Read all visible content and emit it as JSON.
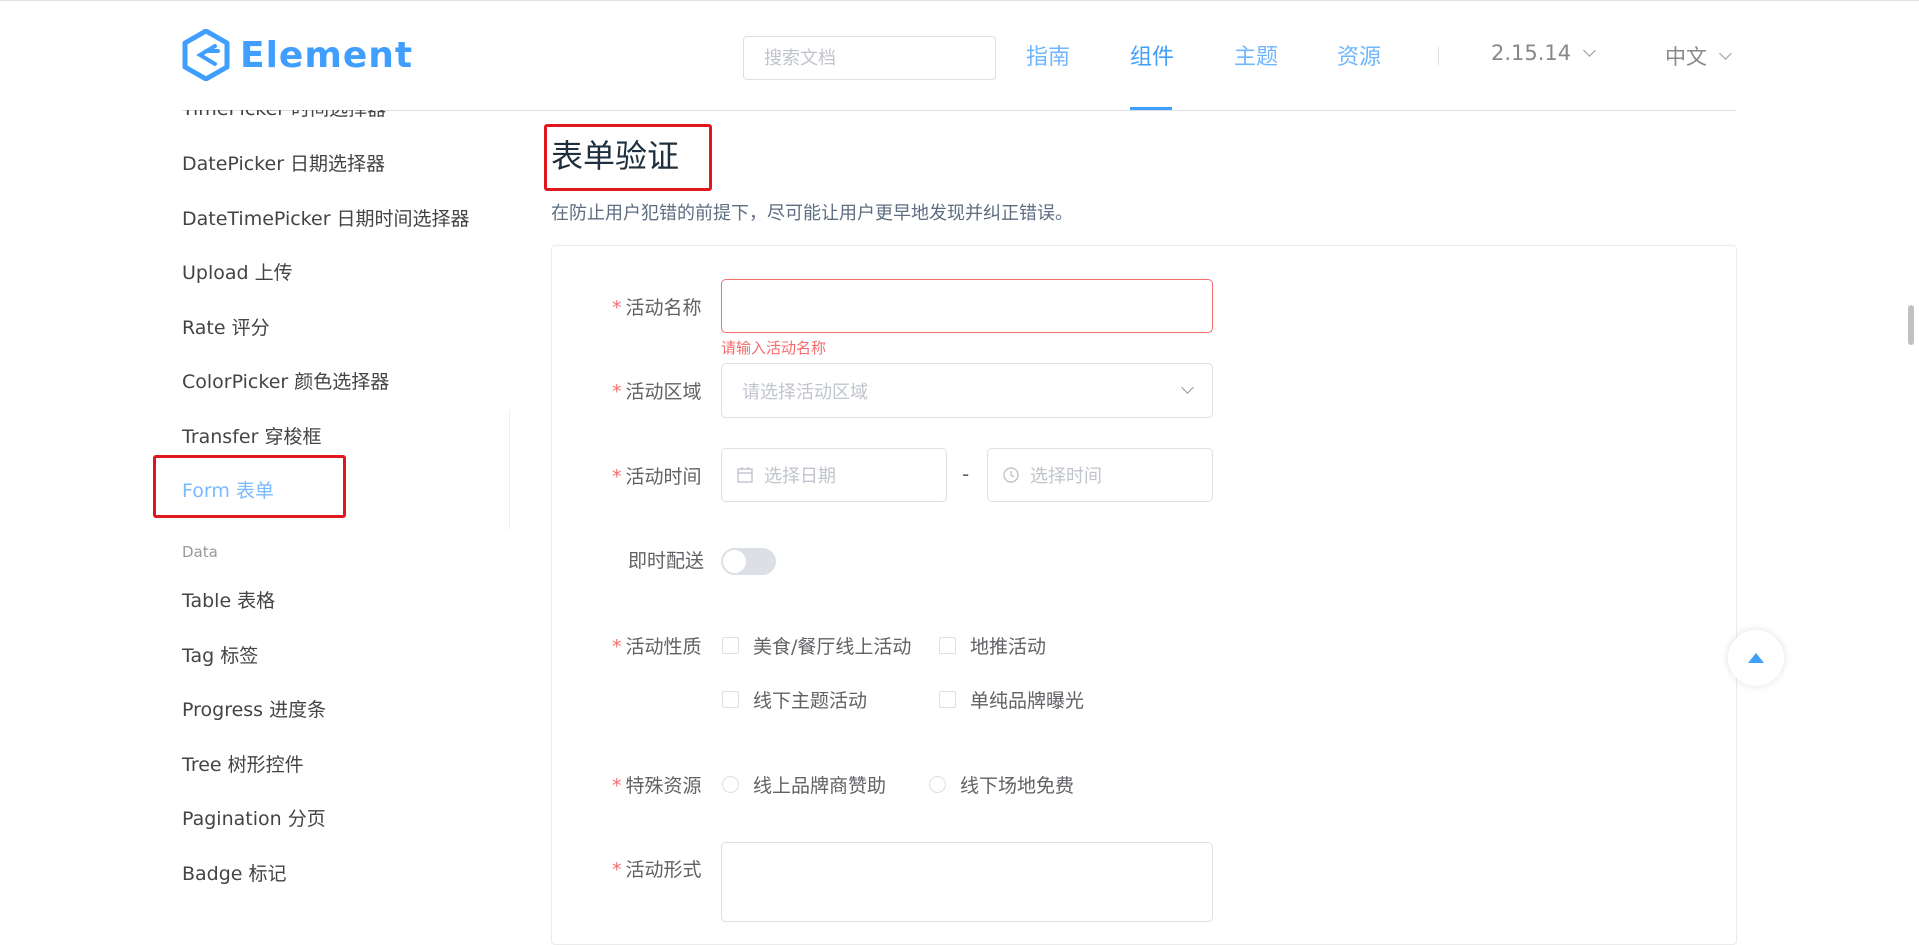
{
  "header": {
    "logo_text": "Element",
    "search_placeholder": "搜索文档",
    "nav": [
      "指南",
      "组件",
      "主题",
      "资源"
    ],
    "version": "2.15.14",
    "language": "中文"
  },
  "sidebar": {
    "items": [
      "TimePicker 时间选择器",
      "DatePicker 日期选择器",
      "DateTimePicker 日期时间选择器",
      "Upload 上传",
      "Rate 评分",
      "ColorPicker 颜色选择器",
      "Transfer 穿梭框",
      "Form 表单"
    ],
    "group_title": "Data",
    "data_items": [
      "Table 表格",
      "Tag 标签",
      "Progress 进度条",
      "Tree 树形控件",
      "Pagination 分页",
      "Badge 标记"
    ]
  },
  "main": {
    "title": "表单验证",
    "description": "在防止用户犯错的前提下，尽可能让用户更早地发现并纠正错误。",
    "form": {
      "required_mark": "*",
      "name_label": "活动名称",
      "name_error": "请输入活动名称",
      "region_label": "活动区域",
      "region_placeholder": "请选择活动区域",
      "time_label": "活动时间",
      "date_placeholder": "选择日期",
      "time_separator": "-",
      "time_placeholder": "选择时间",
      "delivery_label": "即时配送",
      "delivery_on": false,
      "type_label": "活动性质",
      "type_options": [
        "美食/餐厅线上活动",
        "地推活动",
        "线下主题活动",
        "单纯品牌曝光"
      ],
      "resource_label": "特殊资源",
      "resource_options": [
        "线上品牌商赞助",
        "线下场地免费"
      ],
      "form_label": "活动形式"
    }
  },
  "colors": {
    "primary": "#409eff",
    "danger": "#f56c6c",
    "highlight": "#e0181e"
  }
}
